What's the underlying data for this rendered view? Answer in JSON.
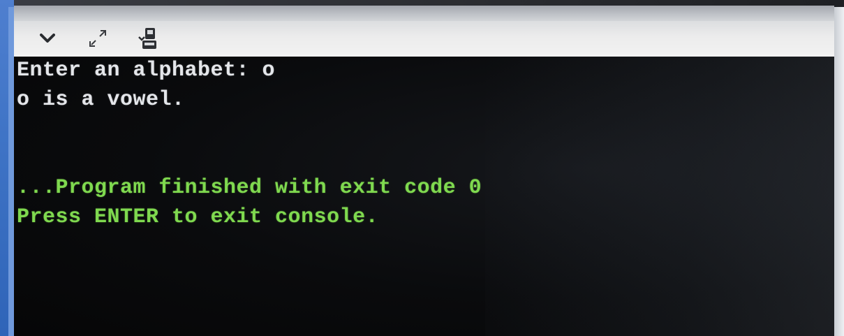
{
  "toolbar": {
    "buttons": [
      {
        "name": "collapse",
        "icon": "chevron-down-icon"
      },
      {
        "name": "expand",
        "icon": "expand-arrows-icon"
      },
      {
        "name": "save",
        "icon": "save-download-icon"
      }
    ]
  },
  "console": {
    "output_lines": [
      "Enter an alphabet: o",
      "o is a vowel."
    ],
    "status_lines": [
      "...Program finished with exit code 0",
      "Press ENTER to exit console."
    ],
    "colors": {
      "output_text": "#e4e6ea",
      "status_text": "#7fd94f",
      "background": "#0a0b0d"
    }
  },
  "window": {
    "edge_color": "#3f74c6"
  }
}
